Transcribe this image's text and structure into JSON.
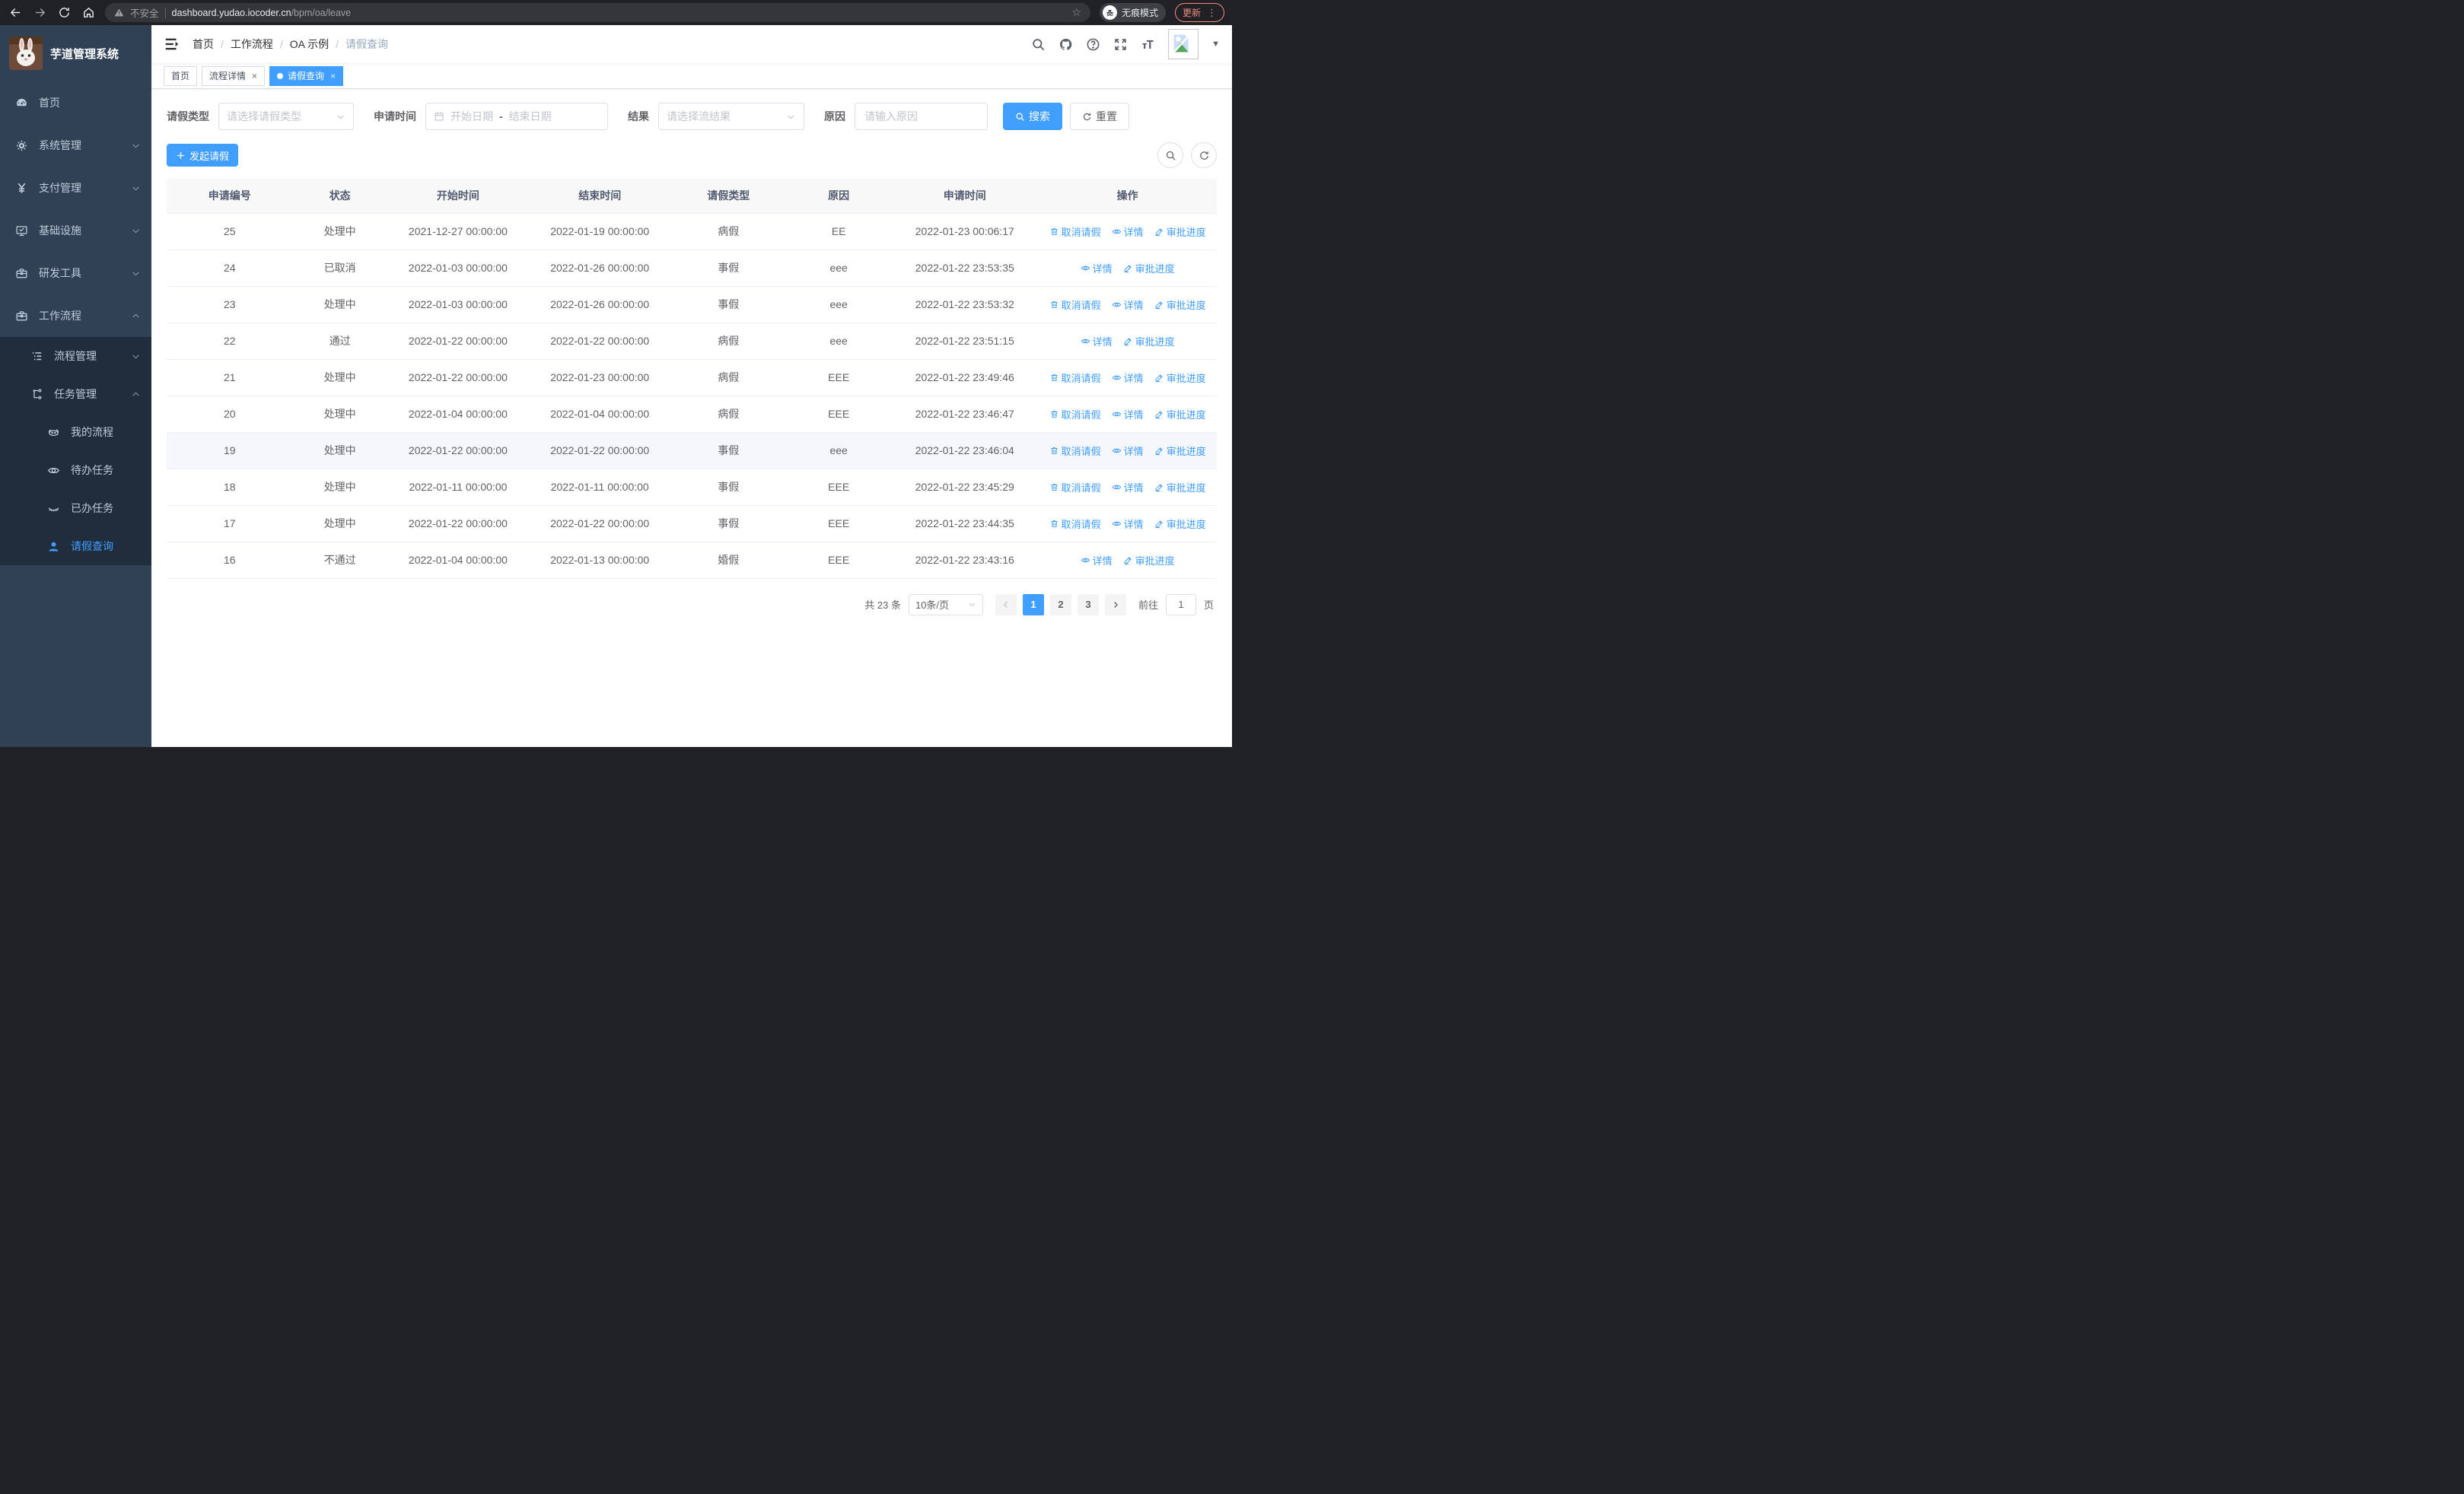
{
  "colors": {
    "accent": "#409eff",
    "sidebar_bg": "#304156",
    "submenu_bg": "#1f2d3d",
    "sidebar_text": "#bfcbd9",
    "update_accent": "#f28b82"
  },
  "browser": {
    "security_label": "不安全",
    "url_host": "dashboard.yudao.iocoder.cn",
    "url_path": "/bpm/oa/leave",
    "incognito_label": "无痕模式",
    "update_label": "更新"
  },
  "sidebar": {
    "title": "芋道管理系统",
    "items": [
      {
        "id": "home",
        "label": "首页",
        "icon": "dashboard-icon",
        "level": 1,
        "dark": false,
        "active": false
      },
      {
        "id": "system",
        "label": "系统管理",
        "icon": "gear-icon",
        "level": 1,
        "dark": false,
        "chevron": "down"
      },
      {
        "id": "payment",
        "label": "支付管理",
        "icon": "yen-icon",
        "level": 1,
        "dark": false,
        "chevron": "down"
      },
      {
        "id": "infra",
        "label": "基础设施",
        "icon": "monitor-icon",
        "level": 1,
        "dark": false,
        "chevron": "down"
      },
      {
        "id": "devtools",
        "label": "研发工具",
        "icon": "toolbox-icon",
        "level": 1,
        "dark": false,
        "chevron": "down"
      },
      {
        "id": "workflow",
        "label": "工作流程",
        "icon": "toolbox-icon",
        "level": 1,
        "dark": false,
        "chevron": "up"
      },
      {
        "id": "process-mgmt",
        "label": "流程管理",
        "icon": "tree-list-icon",
        "level": 2,
        "dark": true,
        "chevron": "down"
      },
      {
        "id": "task-mgmt",
        "label": "任务管理",
        "icon": "flow-icon",
        "level": 2,
        "dark": true,
        "chevron": "up"
      },
      {
        "id": "my-process",
        "label": "我的流程",
        "icon": "robot-icon",
        "level": 3,
        "dark": true
      },
      {
        "id": "todo-task",
        "label": "待办任务",
        "icon": "eye-open-icon",
        "level": 3,
        "dark": true
      },
      {
        "id": "done-task",
        "label": "已办任务",
        "icon": "eye-closed-icon",
        "level": 3,
        "dark": true
      },
      {
        "id": "leave-query",
        "label": "请假查询",
        "icon": "user-icon",
        "level": 3,
        "dark": true,
        "active": true
      }
    ]
  },
  "breadcrumb": {
    "separator": "/",
    "items": [
      "首页",
      "工作流程",
      "OA 示例",
      "请假查询"
    ]
  },
  "tabs": {
    "close_glyph": "×",
    "items": [
      {
        "id": "home",
        "label": "首页",
        "closable": false,
        "active": false
      },
      {
        "id": "process-detail",
        "label": "流程详情",
        "closable": true,
        "active": false
      },
      {
        "id": "leave-query",
        "label": "请假查询",
        "closable": true,
        "active": true
      }
    ]
  },
  "filters": {
    "leave_type": {
      "label": "请假类型",
      "placeholder": "请选择请假类型"
    },
    "apply_time": {
      "label": "申请时间",
      "start_placeholder": "开始日期",
      "separator": "-",
      "end_placeholder": "结束日期"
    },
    "result": {
      "label": "结果",
      "placeholder": "请选择流结果"
    },
    "reason": {
      "label": "原因",
      "placeholder": "请输入原因"
    },
    "search_label": "搜索",
    "reset_label": "重置"
  },
  "toolbar": {
    "create_label": "发起请假"
  },
  "table": {
    "columns": [
      "申请编号",
      "状态",
      "开始时间",
      "结束时间",
      "请假类型",
      "原因",
      "申请时间",
      "操作"
    ],
    "action_labels": {
      "cancel": "取消请假",
      "detail": "详情",
      "progress": "审批进度"
    },
    "rows": [
      {
        "id": "25",
        "status": "处理中",
        "start": "2021-12-27 00:00:00",
        "end": "2022-01-19 00:00:00",
        "type": "病假",
        "reason": "EE",
        "apply_time": "2022-01-23 00:06:17",
        "actions": [
          "cancel",
          "detail",
          "progress"
        ],
        "highlight": false
      },
      {
        "id": "24",
        "status": "已取消",
        "start": "2022-01-03 00:00:00",
        "end": "2022-01-26 00:00:00",
        "type": "事假",
        "reason": "eee",
        "apply_time": "2022-01-22 23:53:35",
        "actions": [
          "detail",
          "progress"
        ],
        "highlight": false
      },
      {
        "id": "23",
        "status": "处理中",
        "start": "2022-01-03 00:00:00",
        "end": "2022-01-26 00:00:00",
        "type": "事假",
        "reason": "eee",
        "apply_time": "2022-01-22 23:53:32",
        "actions": [
          "cancel",
          "detail",
          "progress"
        ],
        "highlight": false
      },
      {
        "id": "22",
        "status": "通过",
        "start": "2022-01-22 00:00:00",
        "end": "2022-01-22 00:00:00",
        "type": "病假",
        "reason": "eee",
        "apply_time": "2022-01-22 23:51:15",
        "actions": [
          "detail",
          "progress"
        ],
        "highlight": false
      },
      {
        "id": "21",
        "status": "处理中",
        "start": "2022-01-22 00:00:00",
        "end": "2022-01-23 00:00:00",
        "type": "病假",
        "reason": "EEE",
        "apply_time": "2022-01-22 23:49:46",
        "actions": [
          "cancel",
          "detail",
          "progress"
        ],
        "highlight": false
      },
      {
        "id": "20",
        "status": "处理中",
        "start": "2022-01-04 00:00:00",
        "end": "2022-01-04 00:00:00",
        "type": "病假",
        "reason": "EEE",
        "apply_time": "2022-01-22 23:46:47",
        "actions": [
          "cancel",
          "detail",
          "progress"
        ],
        "highlight": false
      },
      {
        "id": "19",
        "status": "处理中",
        "start": "2022-01-22 00:00:00",
        "end": "2022-01-22 00:00:00",
        "type": "事假",
        "reason": "eee",
        "apply_time": "2022-01-22 23:46:04",
        "actions": [
          "cancel",
          "detail",
          "progress"
        ],
        "highlight": true
      },
      {
        "id": "18",
        "status": "处理中",
        "start": "2022-01-11 00:00:00",
        "end": "2022-01-11 00:00:00",
        "type": "事假",
        "reason": "EEE",
        "apply_time": "2022-01-22 23:45:29",
        "actions": [
          "cancel",
          "detail",
          "progress"
        ],
        "highlight": false
      },
      {
        "id": "17",
        "status": "处理中",
        "start": "2022-01-22 00:00:00",
        "end": "2022-01-22 00:00:00",
        "type": "事假",
        "reason": "EEE",
        "apply_time": "2022-01-22 23:44:35",
        "actions": [
          "cancel",
          "detail",
          "progress"
        ],
        "highlight": false
      },
      {
        "id": "16",
        "status": "不通过",
        "start": "2022-01-04 00:00:00",
        "end": "2022-01-13 00:00:00",
        "type": "婚假",
        "reason": "EEE",
        "apply_time": "2022-01-22 23:43:16",
        "actions": [
          "detail",
          "progress"
        ],
        "highlight": false
      }
    ]
  },
  "pagination": {
    "total_label": "共 23 条",
    "page_size": "10条/页",
    "pages": [
      "1",
      "2",
      "3"
    ],
    "active_page": "1",
    "goto_label": "前往",
    "goto_value": "1",
    "page_unit": "页"
  }
}
